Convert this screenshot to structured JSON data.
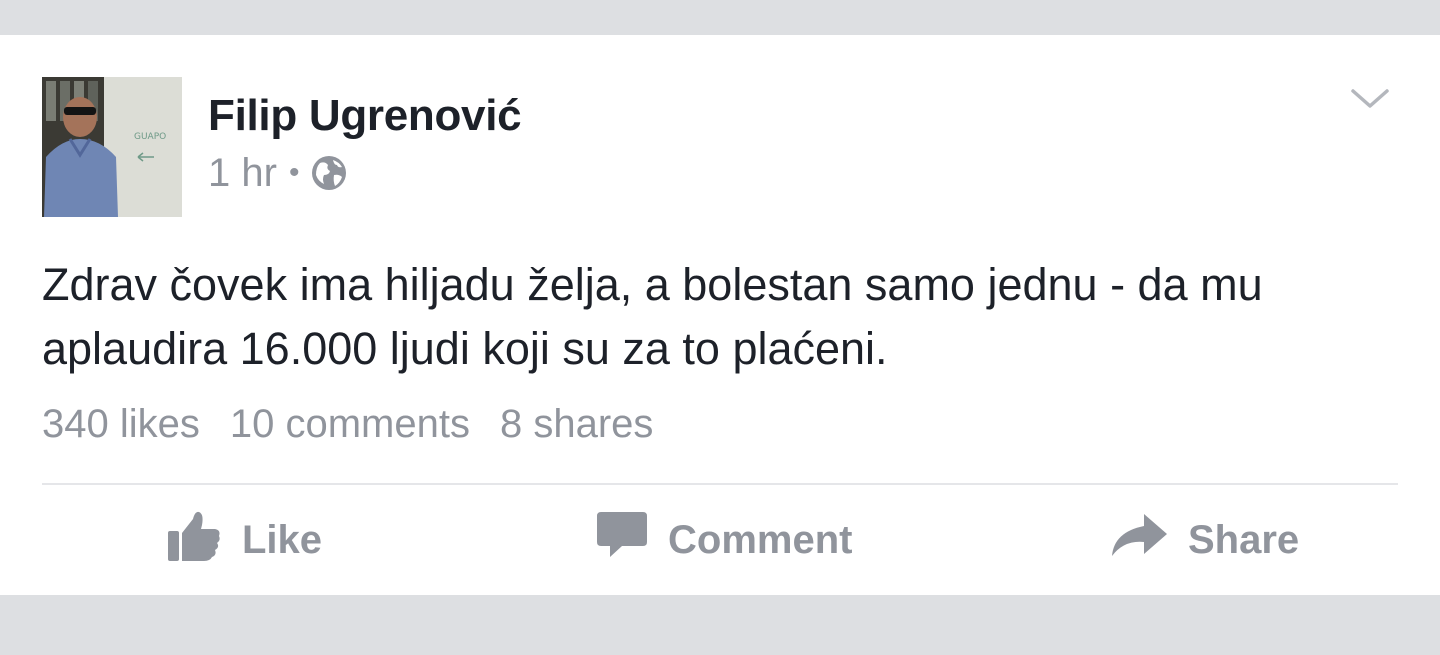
{
  "post": {
    "author": "Filip Ugrenović",
    "time": "1 hr",
    "separator": "•",
    "privacy_icon": "globe-icon",
    "text": "Zdrav čovek ima hiljadu želja, a bolestan samo jednu - da mu aplaudira 16.000 ljudi koji su za to plaćeni."
  },
  "stats": {
    "likes": "340 likes",
    "comments": "10 comments",
    "shares": "8 shares"
  },
  "actions": {
    "like": "Like",
    "comment": "Comment",
    "share": "Share"
  },
  "avatar_text": "GUAPO",
  "colors": {
    "page_background": "#dddfe2",
    "card_background": "#ffffff",
    "primary_text": "#1d2129",
    "secondary_text": "#90949c",
    "divider": "#e5e6e9"
  }
}
